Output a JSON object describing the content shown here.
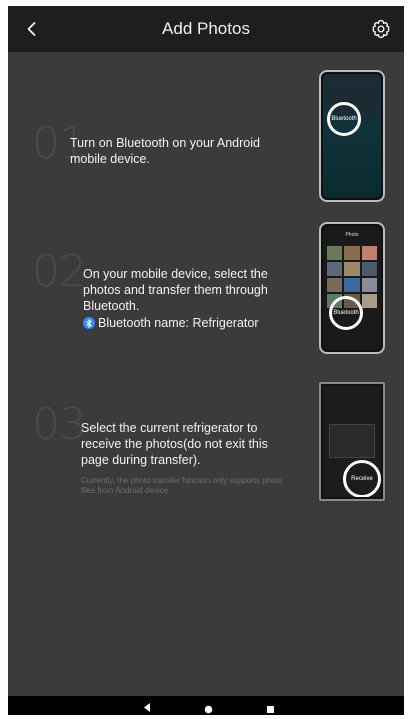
{
  "header": {
    "title": "Add Photos"
  },
  "steps": [
    {
      "number": "01",
      "text": "Turn on Bluetooth on your Android mobile device.",
      "illustration_label": "Bluetooth"
    },
    {
      "number": "02",
      "text": "On your mobile device, select the photos and transfer them through Bluetooth.",
      "bluetooth_name": "Bluetooth name: Refrigerator",
      "illustration_label": "Bluetooth",
      "illustration_title": "Photo"
    },
    {
      "number": "03",
      "text": "Select the current refrigerator to receive the photos(do not exit this page during transfer).",
      "note": "Currently, the photo transfer function only supports photo files from Android device.",
      "illustration_label": "Receive"
    }
  ],
  "navbar": {
    "back": "back-icon",
    "home": "home-icon",
    "recents": "recents-icon"
  },
  "colors": {
    "background": "#3b3b3b",
    "header": "#1e1e1e",
    "bluetooth": "#2f8cff"
  }
}
